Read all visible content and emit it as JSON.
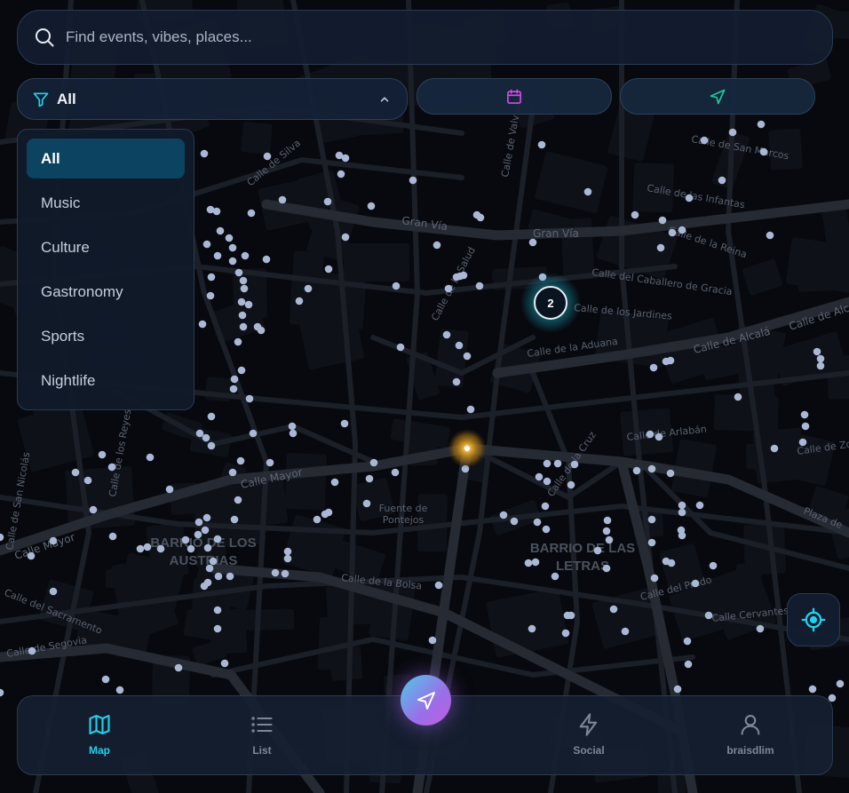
{
  "search": {
    "placeholder": "Find events, vibes, places..."
  },
  "filter": {
    "selected": "All"
  },
  "dropdown": {
    "options": [
      "All",
      "Music",
      "Culture",
      "Gastronomy",
      "Sports",
      "Nightlife"
    ],
    "active_index": 0
  },
  "map": {
    "cluster_count": "2",
    "streets": [
      "Gran Vía",
      "Gran Vía",
      "Calle de Alcalá",
      "Calle del Caballero de Gracia",
      "Calle de la Aduana",
      "Calle de los Jardines",
      "Calle de las Infantas",
      "Calle de la Reina",
      "Calle de San Marcos",
      "Calle de Arlabán",
      "Calle de Zo",
      "Calle de la Cruz",
      "Calle del Prado",
      "Calle Cervantes",
      "Calle Mayor",
      "Calle Mayor",
      "Calle de la Bolsa",
      "Calle de Silva",
      "Calle de Valverde",
      "Calle de la Salud",
      "Calle del Sacramento",
      "Calle de Segovia",
      "Calle de San Nicolás",
      "Calle de Alcalá",
      "Plaza de",
      "Calle de los Reyes"
    ],
    "districts": {
      "austrias": [
        "BARRIO DE LOS",
        "AUSTRIAS"
      ],
      "letras": [
        "BARRIO DE LAS",
        "LETRAS"
      ]
    },
    "poi": [
      "Fuente de",
      "Pontejos"
    ]
  },
  "nav": {
    "items": [
      {
        "label": "Map",
        "icon": "map-icon",
        "active": true
      },
      {
        "label": "List",
        "icon": "list-icon",
        "active": false
      },
      {
        "label": "Social",
        "icon": "zap-icon",
        "active": false
      },
      {
        "label": "braisdlim",
        "icon": "user-icon",
        "active": false
      }
    ]
  },
  "colors": {
    "accent": "#1fd2ee",
    "calendar": "#d946ef",
    "nearby": "#22c79a",
    "marker": "#aab8d6",
    "user_location": "#d8a21a"
  }
}
